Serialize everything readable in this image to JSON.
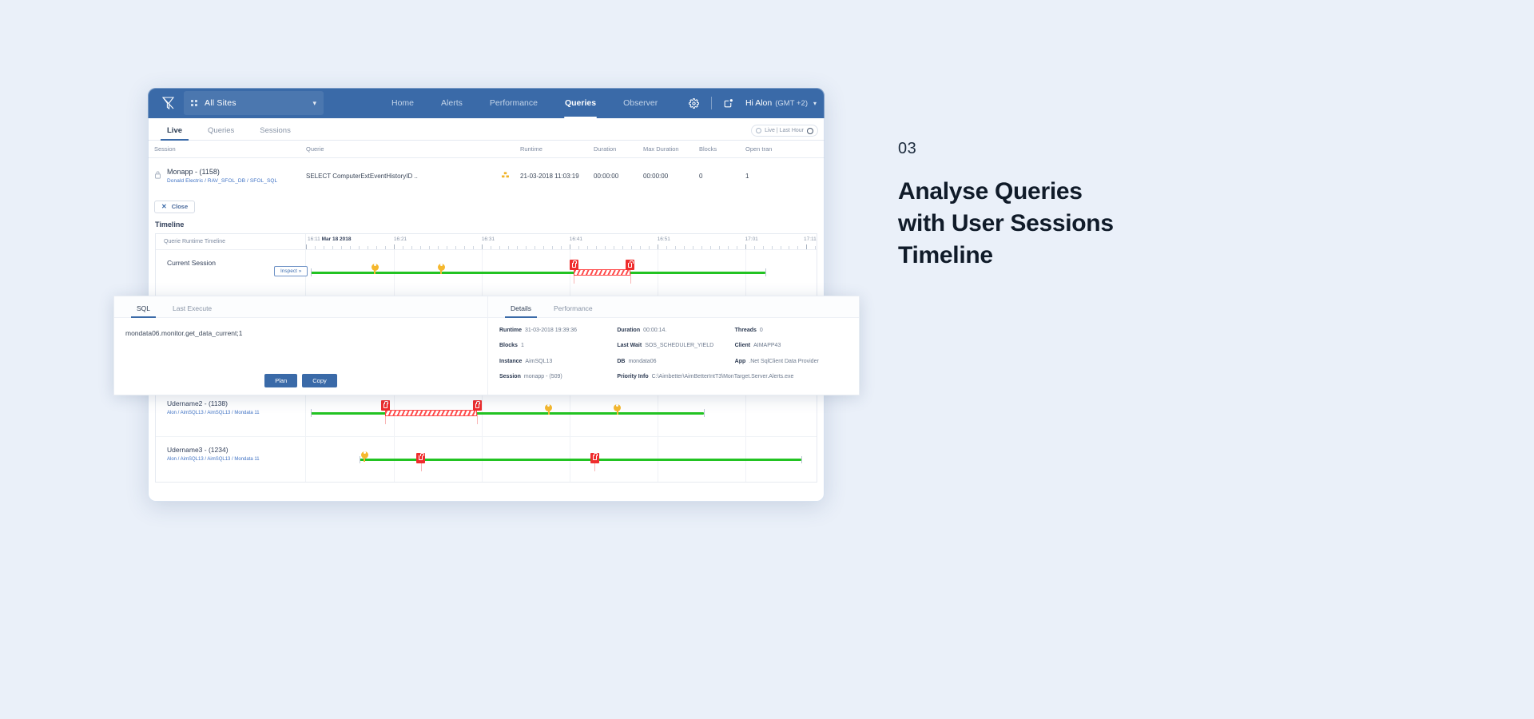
{
  "header": {
    "logo": "filter-logo-icon",
    "site_selector": {
      "label": "All Sites",
      "icon": "grid-icon",
      "chevron": "chevron-down-icon"
    },
    "nav": [
      {
        "label": "Home",
        "active": false
      },
      {
        "label": "Alerts",
        "active": false
      },
      {
        "label": "Performance",
        "active": false
      },
      {
        "label": "Queries",
        "active": true
      },
      {
        "label": "Observer",
        "active": false
      }
    ],
    "settings_icon": "gear-icon",
    "notification_icon": "notification-window-icon",
    "user": {
      "greeting": "Hi Alon",
      "timezone": "(GMT +2)",
      "chevron": "chevron-down-icon"
    }
  },
  "subtabs": {
    "items": [
      {
        "label": "Live",
        "active": true
      },
      {
        "label": "Queries",
        "active": false
      },
      {
        "label": "Sessions",
        "active": false
      }
    ],
    "live_control": {
      "label": "Live | Last Hour",
      "clock_icon": "clock-icon",
      "record_icon": "record-icon"
    }
  },
  "query_table": {
    "columns": [
      "Session",
      "Querie",
      "",
      "Runtime",
      "Duration",
      "Max Duration",
      "Blocks",
      "Open tran"
    ],
    "rows": [
      {
        "session_title": "Monapp - (1158)",
        "session_sub": "Donald Electric / RAV_SFOL_DB / SFOL_SQL",
        "lock_icon": "lock-icon",
        "querie": "SELECT ComputerExtEventHistoryID ..",
        "wait_icon": "blocked-warning-icon",
        "runtime": "21-03-2018  11:03:19",
        "duration": "00:00:00",
        "max_duration": "00:00:00",
        "blocks": "0",
        "open_tran": "1"
      }
    ]
  },
  "close_button": {
    "label": "Close",
    "icon": "close-x-icon"
  },
  "timeline": {
    "title": "Timeline",
    "column_header": "Querie Runtime Timeline",
    "ticks": [
      {
        "label": "16:11",
        "bold_suffix": "Mar 18 2018",
        "pct": 0
      },
      {
        "label": "16:21",
        "pct": 17.2
      },
      {
        "label": "16:31",
        "pct": 34.4
      },
      {
        "label": "16:41",
        "pct": 51.6
      },
      {
        "label": "16:51",
        "pct": 68.8
      },
      {
        "label": "17:01",
        "pct": 86.0
      },
      {
        "label": "17:11",
        "pct": 97.5
      }
    ],
    "rows": [
      {
        "name": "Current Session",
        "sub": "",
        "inspect_label": "Inspect »",
        "bar": {
          "start_pct": 1,
          "end_pct": 90
        },
        "pins": [
          13.5,
          26.5
        ],
        "locks": [
          52.5,
          63.5
        ],
        "hatch": {
          "start_pct": 52.5,
          "end_pct": 63.5
        }
      },
      {
        "name": "Udername2 - (1138)",
        "sub": "Alon / AimSQL13 / AimSQL13 / Mondata 11",
        "bar": {
          "start_pct": 1,
          "end_pct": 78
        },
        "pins": [
          47.5,
          61.0
        ],
        "locks": [
          15.5,
          33.5
        ],
        "hatch": {
          "start_pct": 15.5,
          "end_pct": 33.5
        }
      },
      {
        "name": "Udername3 - (1234)",
        "sub": "Alon / AimSQL13 / AimSQL13 / Mondata 11",
        "bar": {
          "start_pct": 10.5,
          "end_pct": 97
        },
        "pins": [
          11.5
        ],
        "locks": [
          22.5,
          56.5
        ],
        "hatch": null
      }
    ]
  },
  "detail_panel": {
    "left_tabs": [
      {
        "label": "SQL",
        "active": true
      },
      {
        "label": "Last Execute",
        "active": false
      }
    ],
    "sql_text": "mondata06.monitor.get_data_current;1",
    "actions": [
      {
        "label": "Plan"
      },
      {
        "label": "Copy"
      }
    ],
    "right_tabs": [
      {
        "label": "Details",
        "active": true
      },
      {
        "label": "Performance",
        "active": false
      }
    ],
    "fields": [
      {
        "label": "Runtime",
        "value": "31-03-2018 19:39:36"
      },
      {
        "label": "Duration",
        "value": "00:00:14."
      },
      {
        "label": "Threads",
        "value": "0"
      },
      {
        "label": "Blocks",
        "value": "1"
      },
      {
        "label": "Last Wait",
        "value": "SOS_SCHEDULER_YIELD"
      },
      {
        "label": "Client",
        "value": "AIMAPP43"
      },
      {
        "label": "Instance",
        "value": "AimSQL13"
      },
      {
        "label": "DB",
        "value": "mondata06"
      },
      {
        "label": "App",
        "value": ".Net SqlClient Data Provider"
      },
      {
        "label": "Session",
        "value": "monapp - (509)"
      },
      {
        "label": "Priority Info",
        "value": "C:\\Aimbetter\\AimBetterIntT3\\MonTarget.Server.Alerts.exe"
      },
      {
        "label": "",
        "value": ""
      }
    ]
  },
  "caption": {
    "number": "03",
    "headline_line1": "Analyse Queries",
    "headline_line2": "with User Sessions",
    "headline_line3": "Timeline"
  },
  "colors": {
    "brand_blue": "#3a6aa8",
    "page_bg": "#eaf0f9",
    "bar_green": "#22c322",
    "lock_red": "#ef2d2d",
    "pin_yellow": "#f5b82e",
    "link_blue": "#3f72c4"
  }
}
